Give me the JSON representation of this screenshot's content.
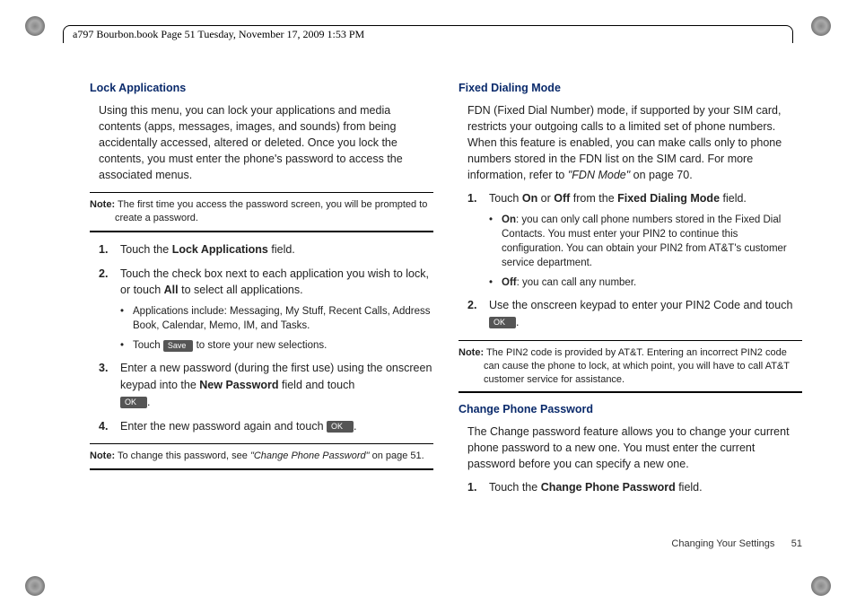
{
  "meta": {
    "header": "a797 Bourbon.book  Page 51  Tuesday, November 17, 2009  1:53 PM"
  },
  "left": {
    "h1": "Lock Applications",
    "p1": "Using this menu, you can lock your applications and media contents (apps, messages, images, and sounds) from being accidentally accessed, altered or deleted. Once you lock the contents, you must enter the phone's password to access the associated menus.",
    "note1_label": "Note:",
    "note1_text": " The first time you access the password screen, you will be prompted to create a password.",
    "s1_a": "Touch the ",
    "s1_b": "Lock Applications",
    "s1_c": " field.",
    "s2_a": "Touch the check box next to each application you wish to lock, or touch ",
    "s2_b": "All",
    "s2_c": " to select all applications.",
    "s2_bul1": "Applications include: Messaging, My Stuff, Recent Calls, Address Book, Calendar, Memo, IM, and Tasks.",
    "s2_bul2_a": "Touch ",
    "s2_bul2_btn": "Save",
    "s2_bul2_b": " to store your new selections.",
    "s3_a": "Enter a new password (during the first use) using the onscreen keypad into the ",
    "s3_b": "New Password",
    "s3_c": " field and touch ",
    "s3_btn": "OK",
    "s3_d": ".",
    "s4_a": "Enter the new password again and touch ",
    "s4_btn": "OK",
    "s4_b": ".",
    "note2_label": "Note:",
    "note2_a": " To change this password, see ",
    "note2_i": "\"Change Phone Password\"",
    "note2_b": " on page 51."
  },
  "right": {
    "h1": "Fixed Dialing Mode",
    "p1_a": "FDN (Fixed Dial Number) mode, if supported by your SIM card, restricts your outgoing calls to a limited set of phone numbers. When this feature is enabled, you can make calls only to phone numbers stored in the FDN list on the SIM card. For more information, refer to ",
    "p1_i": "\"FDN Mode\"",
    "p1_b": "  on page 70.",
    "s1_a": "Touch ",
    "s1_b": "On",
    "s1_c": " or ",
    "s1_d": "Off",
    "s1_e": " from the ",
    "s1_f": "Fixed Dialing Mode",
    "s1_g": " field.",
    "bul1_a": "On",
    "bul1_b": ": you can only call phone numbers stored in the Fixed Dial Contacts. You must enter your PIN2 to continue this configuration. You can obtain your PIN2 from AT&T's customer service department.",
    "bul2_a": "Off",
    "bul2_b": ": you can call any number.",
    "s2_a": "Use the onscreen keypad to enter your PIN2 Code and touch ",
    "s2_btn": "OK",
    "s2_b": ".",
    "note_label": "Note:",
    "note_text": " The PIN2 code is provided by AT&T. Entering an incorrect PIN2 code can cause the phone to lock, at which point, you will have to call AT&T customer service for assistance.",
    "h2": "Change Phone Password",
    "p2": "The Change password feature allows you to change your current phone password to a new one. You must enter the current password before you can specify a new one.",
    "cp_s1_a": "Touch the ",
    "cp_s1_b": "Change Phone Password",
    "cp_s1_c": " field."
  },
  "footer": {
    "section": "Changing Your Settings",
    "page": "51"
  }
}
